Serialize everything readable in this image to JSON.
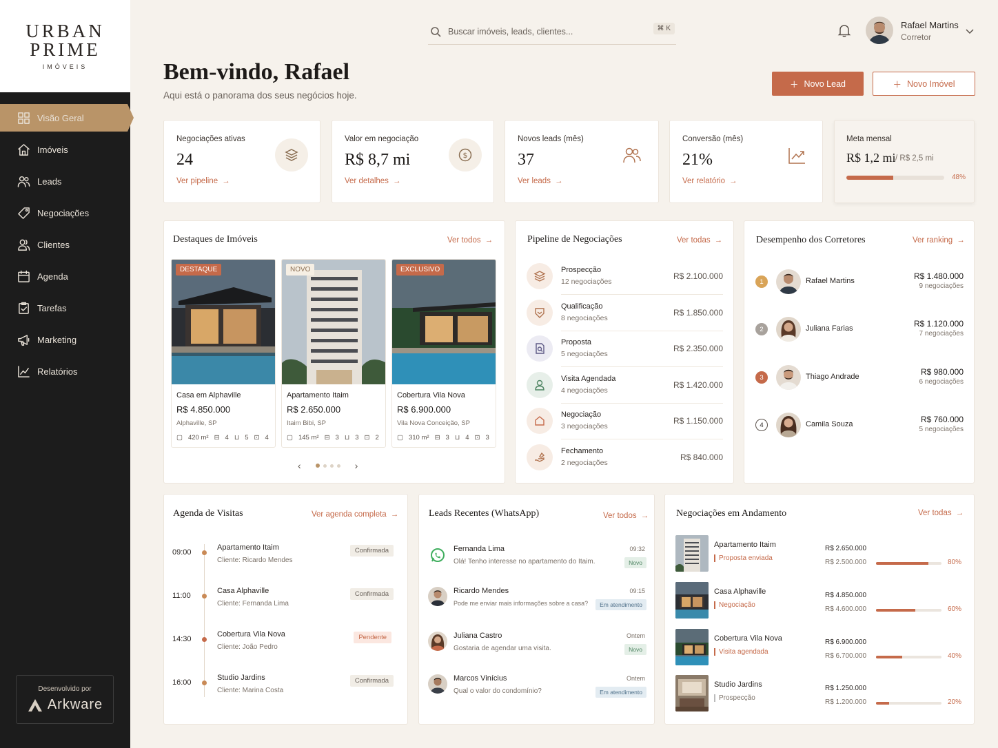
{
  "brand": {
    "line1": "URBAN",
    "line2": "PRIME",
    "line3": "IMÓVEIS"
  },
  "sidebar": {
    "items": [
      {
        "label": "Visão Geral",
        "icon": "grid-icon",
        "active": true
      },
      {
        "label": "Imóveis",
        "icon": "home-icon"
      },
      {
        "label": "Leads",
        "icon": "users-icon"
      },
      {
        "label": "Negociações",
        "icon": "tag-icon"
      },
      {
        "label": "Clientes",
        "icon": "user-group-icon"
      },
      {
        "label": "Agenda",
        "icon": "calendar-icon"
      },
      {
        "label": "Tarefas",
        "icon": "clipboard-check-icon"
      },
      {
        "label": "Marketing",
        "icon": "megaphone-icon"
      },
      {
        "label": "Relatórios",
        "icon": "chart-line-icon"
      }
    ],
    "developed_by": "Desenvolvido por",
    "dev_brand": "Arkware"
  },
  "search": {
    "placeholder": "Buscar imóveis, leads, clientes...",
    "shortcut": "⌘ K"
  },
  "user": {
    "name": "Rafael Martins",
    "role": "Corretor"
  },
  "header": {
    "title": "Bem-vindo, Rafael",
    "subtitle": "Aqui está o panorama dos seus negócios hoje."
  },
  "actions": {
    "new_lead": "Novo Lead",
    "new_property": "Novo Imóvel"
  },
  "stats": [
    {
      "label": "Negociações ativas",
      "value": "24",
      "link": "Ver pipeline"
    },
    {
      "label": "Valor em negociação",
      "value": "R$ 8,7 mi",
      "link": "Ver detalhes"
    },
    {
      "label": "Novos leads (mês)",
      "value": "37",
      "link": "Ver leads"
    },
    {
      "label": "Conversão (mês)",
      "value": "21%",
      "link": "Ver relatório"
    }
  ],
  "goal": {
    "label": "Meta mensal",
    "value": "R$ 1,2 mi",
    "target": "/ R$ 2,5 mi",
    "percent": "48%",
    "fraction": 0.48
  },
  "properties": {
    "title": "Destaques de Imóveis",
    "link": "Ver todos",
    "items": [
      {
        "badge": "DESTAQUE",
        "name": "Casa em Alphaville",
        "price": "R$ 4.850.000",
        "location": "Alphaville, SP",
        "area": "420 m²",
        "beds": "4",
        "baths": "5",
        "cars": "4"
      },
      {
        "badge": "NOVO",
        "name": "Apartamento Itaim",
        "price": "R$ 2.650.000",
        "location": "Itaim Bibi, SP",
        "area": "145 m²",
        "beds": "3",
        "baths": "3",
        "cars": "2"
      },
      {
        "badge": "EXCLUSIVO",
        "name": "Cobertura Vila Nova",
        "price": "R$ 6.900.000",
        "location": "Vila Nova Conceição, SP",
        "area": "310 m²",
        "beds": "3",
        "baths": "4",
        "cars": "3"
      }
    ],
    "active_page": 1,
    "pages": 4
  },
  "pipeline": {
    "title": "Pipeline de Negociações",
    "link": "Ver todas",
    "stages": [
      {
        "name": "Prospecção",
        "count": "12 negociações",
        "value": "R$ 2.100.000"
      },
      {
        "name": "Qualificação",
        "count": "8 negociações",
        "value": "R$ 1.850.000"
      },
      {
        "name": "Proposta",
        "count": "5 negociações",
        "value": "R$ 2.350.000"
      },
      {
        "name": "Visita Agendada",
        "count": "4 negociações",
        "value": "R$ 1.420.000"
      },
      {
        "name": "Negociação",
        "count": "3 negociações",
        "value": "R$ 1.150.000"
      },
      {
        "name": "Fechamento",
        "count": "2 negociações",
        "value": "R$ 840.000"
      }
    ]
  },
  "brokers": {
    "title": "Desempenho dos Corretores",
    "link": "Ver ranking",
    "items": [
      {
        "rank": "1",
        "name": "Rafael Martins",
        "value": "R$ 1.480.000",
        "deals": "9 negociações"
      },
      {
        "rank": "2",
        "name": "Juliana Farias",
        "value": "R$ 1.120.000",
        "deals": "7 negociações"
      },
      {
        "rank": "3",
        "name": "Thiago Andrade",
        "value": "R$ 980.000",
        "deals": "6 negociações"
      },
      {
        "rank": "4",
        "name": "Camila Souza",
        "value": "R$ 760.000",
        "deals": "5 negociações"
      }
    ]
  },
  "agenda": {
    "title": "Agenda de Visitas",
    "link": "Ver agenda completa",
    "items": [
      {
        "time": "09:00",
        "property": "Apartamento Itaim",
        "client": "Cliente: Ricardo Mendes",
        "status": "Confirmada"
      },
      {
        "time": "11:00",
        "property": "Casa Alphaville",
        "client": "Cliente: Fernanda Lima",
        "status": "Confirmada"
      },
      {
        "time": "14:30",
        "property": "Cobertura Vila Nova",
        "client": "Cliente: João Pedro",
        "status": "Pendente"
      },
      {
        "time": "16:00",
        "property": "Studio Jardins",
        "client": "Cliente: Marina Costa",
        "status": "Confirmada"
      }
    ]
  },
  "leads": {
    "title": "Leads Recentes (WhatsApp)",
    "link": "Ver todos",
    "items": [
      {
        "name": "Fernanda Lima",
        "message": "Olá! Tenho interesse no apartamento do Itaim.",
        "time": "09:32",
        "status": "Novo"
      },
      {
        "name": "Ricardo Mendes",
        "message": "Pode me enviar mais informações sobre a casa?",
        "time": "09:15",
        "status": "Em atendimento"
      },
      {
        "name": "Juliana Castro",
        "message": "Gostaria de agendar uma visita.",
        "time": "Ontem",
        "status": "Novo"
      },
      {
        "name": "Marcos Vinícius",
        "message": "Qual o valor do condomínio?",
        "time": "Ontem",
        "status": "Em atendimento"
      }
    ]
  },
  "deals": {
    "title": "Negociações em Andamento",
    "link": "Ver todas",
    "items": [
      {
        "name": "Apartamento Itaim",
        "phase": "Proposta enviada",
        "asking": "R$ 2.650.000",
        "offer": "R$ 2.500.000",
        "percent": "80%",
        "fraction": 0.8
      },
      {
        "name": "Casa Alphaville",
        "phase": "Negociação",
        "asking": "R$ 4.850.000",
        "offer": "R$ 4.600.000",
        "percent": "60%",
        "fraction": 0.6
      },
      {
        "name": "Cobertura Vila Nova",
        "phase": "Visita agendada",
        "asking": "R$ 6.900.000",
        "offer": "R$ 6.700.000",
        "percent": "40%",
        "fraction": 0.4
      },
      {
        "name": "Studio Jardins",
        "phase": "Prospecção",
        "asking": "R$ 1.250.000",
        "offer": "R$ 1.200.000",
        "percent": "20%",
        "fraction": 0.2
      }
    ]
  },
  "colors": {
    "accent": "#c56a4a",
    "gold": "#b99468",
    "sidebar": "#1c1c1c",
    "background": "#f6f2ec"
  }
}
